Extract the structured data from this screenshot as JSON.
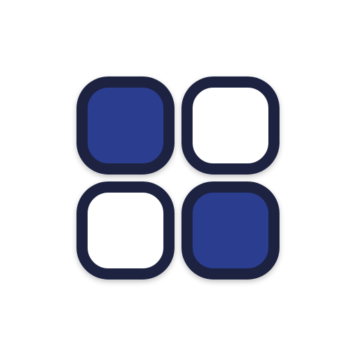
{
  "icon": {
    "name": "grid-icon",
    "tiles": [
      {
        "name": "tile-top-left",
        "filled": true
      },
      {
        "name": "tile-top-right",
        "filled": false
      },
      {
        "name": "tile-bottom-left",
        "filled": false
      },
      {
        "name": "tile-bottom-right",
        "filled": true
      }
    ]
  },
  "colors": {
    "background": "#ffffff",
    "outline": "#1f2140",
    "fill_accent": "#2b3d8f",
    "fill_empty": "#ffffff",
    "shadow": "#c8c9d6"
  }
}
